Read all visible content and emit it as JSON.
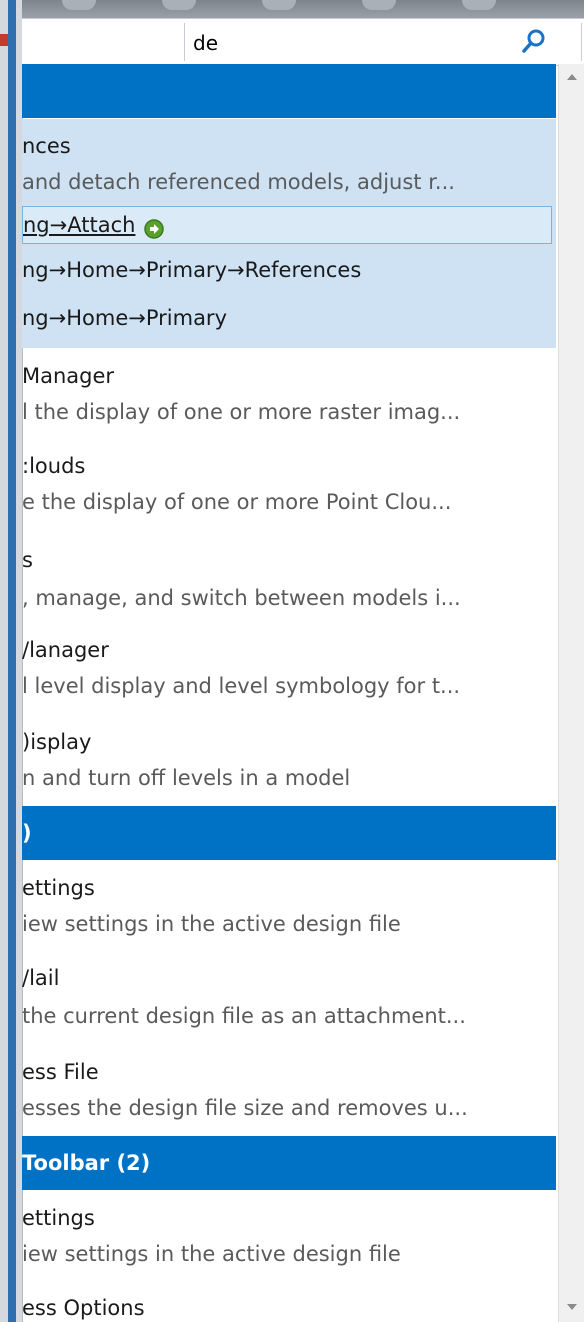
{
  "search": {
    "value": "de"
  },
  "groups": [
    {
      "header": "",
      "selected_item": {
        "title": "nces",
        "description": "and detach referenced models, adjust r...",
        "paths": [
          {
            "text": "ng→Attach",
            "has_go_icon": true,
            "focused": true
          },
          {
            "text": "ng→Home→Primary→References",
            "has_go_icon": false,
            "focused": false
          },
          {
            "text": "ng→Home→Primary",
            "has_go_icon": false,
            "focused": false
          }
        ]
      },
      "items": [
        {
          "title": "Manager",
          "description": "l the display of one or more raster imag..."
        },
        {
          "title": ":louds",
          "description": "e the display of one or more Point Clou..."
        },
        {
          "title": "s",
          "description": ", manage, and switch between models i..."
        },
        {
          "title": "/lanager",
          "description": "l level display and level symbology for t..."
        },
        {
          "title": ")isplay",
          "description": "n and turn off levels in a model"
        }
      ]
    },
    {
      "header": ")",
      "items": [
        {
          "title": "ettings",
          "description": "iew settings in the active design file"
        },
        {
          "title": "/lail",
          "description": "the current design file as an attachment..."
        },
        {
          "title": "ess File",
          "description": "esses the design file size and removes u..."
        }
      ]
    },
    {
      "header": "Toolbar (2)",
      "items": [
        {
          "title": "ettings",
          "description": "iew settings in the active design file"
        },
        {
          "title": "ess Options",
          "description": ""
        }
      ]
    }
  ],
  "colors": {
    "group_header_bg": "#0072c6",
    "selected_bg": "#cfe2f3",
    "search_icon": "#1a73c8",
    "go_icon": "#5aa02c"
  },
  "icons": {
    "search": "search-icon",
    "dropdown": "chevron-down-icon",
    "go": "go-arrow-icon",
    "scroll_up": "scroll-up-arrow-icon",
    "scroll_down": "scroll-down-arrow-icon"
  }
}
